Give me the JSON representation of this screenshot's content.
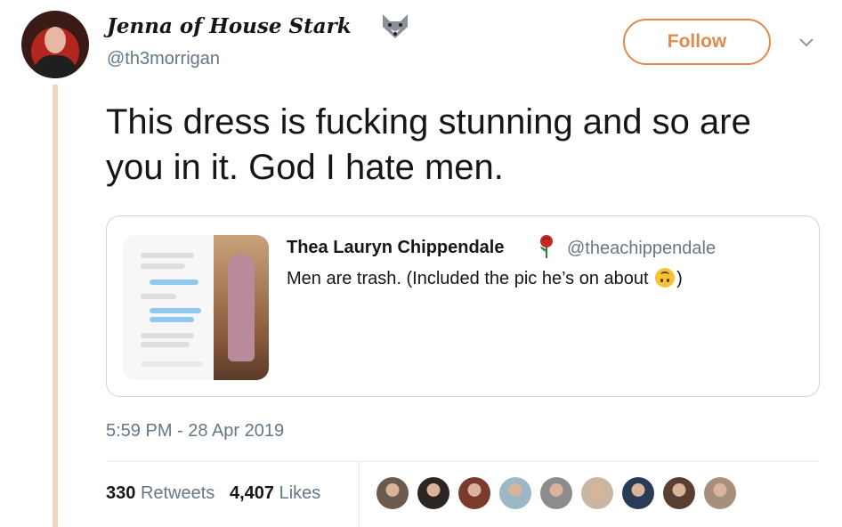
{
  "author": {
    "display_name": "Jenna of House Stark",
    "handle": "@th3morrigan",
    "badge_icon": "wolf-icon"
  },
  "follow_label": "Follow",
  "menu_icon": "chevron-down-icon",
  "tweet": {
    "text": "This dress is fucking stunning and so are you in it. God I hate men."
  },
  "quoted_tweet": {
    "display_name": "Thea Lauryn Chippendale",
    "badge_icon": "rose-icon",
    "handle": "@theachippendale",
    "text_before_emoji": "Men are trash. (Included the pic he’s on about ",
    "emoji_icon": "upside-down-face-icon",
    "text_after_emoji": ")"
  },
  "timestamp": "5:59 PM - 28 Apr 2019",
  "stats": {
    "retweets_count": "330",
    "retweets_label": "Retweets",
    "likes_count": "4,407",
    "likes_label": "Likes"
  },
  "colors": {
    "accent": "#e0894d",
    "thread_line": "#f0d6bd",
    "secondary_text": "#657786"
  },
  "likers": [
    {
      "color": "#6b5a4e"
    },
    {
      "color": "#2b2624"
    },
    {
      "color": "#7a3b2c"
    },
    {
      "color": "#9ab8c6"
    },
    {
      "color": "#8c8c8c"
    },
    {
      "color": "#c9b7a1"
    },
    {
      "color": "#2a3b55"
    },
    {
      "color": "#5a3e34"
    },
    {
      "color": "#a78f7e"
    }
  ]
}
